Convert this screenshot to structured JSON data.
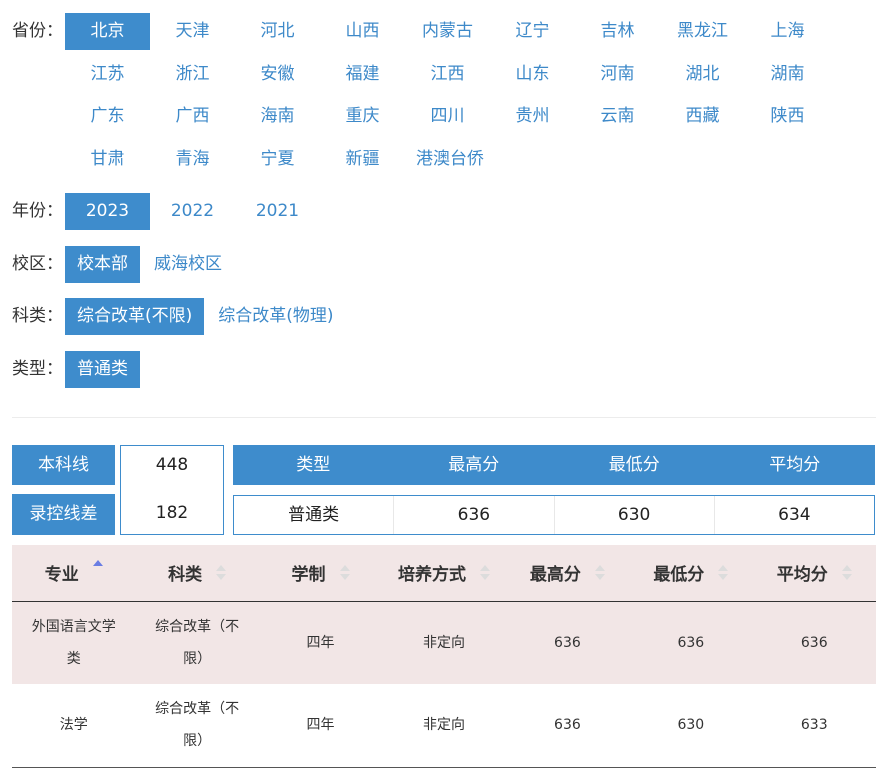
{
  "filters": {
    "province": {
      "label": "省份：",
      "options": [
        "北京",
        "天津",
        "河北",
        "山西",
        "内蒙古",
        "辽宁",
        "吉林",
        "黑龙江",
        "上海",
        "江苏",
        "浙江",
        "安徽",
        "福建",
        "江西",
        "山东",
        "河南",
        "湖北",
        "湖南",
        "广东",
        "广西",
        "海南",
        "重庆",
        "四川",
        "贵州",
        "云南",
        "西藏",
        "陕西",
        "甘肃",
        "青海",
        "宁夏",
        "新疆",
        "港澳台侨"
      ],
      "selected": "北京"
    },
    "year": {
      "label": "年份：",
      "options": [
        "2023",
        "2022",
        "2021"
      ],
      "selected": "2023"
    },
    "campus": {
      "label": "校区：",
      "options": [
        "校本部",
        "威海校区"
      ],
      "selected": "校本部"
    },
    "subject": {
      "label": "科类：",
      "options": [
        "综合改革(不限)",
        "综合改革(物理)"
      ],
      "selected": "综合改革(不限)"
    },
    "type": {
      "label": "类型：",
      "options": [
        "普通类"
      ],
      "selected": "普通类"
    }
  },
  "stats": {
    "line_label": "本科线",
    "line_value": "448",
    "diff_label": "录控线差",
    "diff_value": "182"
  },
  "summary": {
    "headers": [
      "类型",
      "最高分",
      "最低分",
      "平均分"
    ],
    "row": [
      "普通类",
      "636",
      "630",
      "634"
    ]
  },
  "majors": {
    "headers": [
      "专业",
      "科类",
      "学制",
      "培养方式",
      "最高分",
      "最低分",
      "平均分"
    ],
    "rows": [
      [
        "外国语言文学类",
        "综合改革（不限）",
        "四年",
        "非定向",
        "636",
        "636",
        "636"
      ],
      [
        "法学",
        "综合改革（不限）",
        "四年",
        "非定向",
        "636",
        "630",
        "633"
      ]
    ]
  },
  "colors": {
    "accent": "#3e8ccc",
    "link": "#3d89c9",
    "row_tint": "#f2e6e6"
  }
}
